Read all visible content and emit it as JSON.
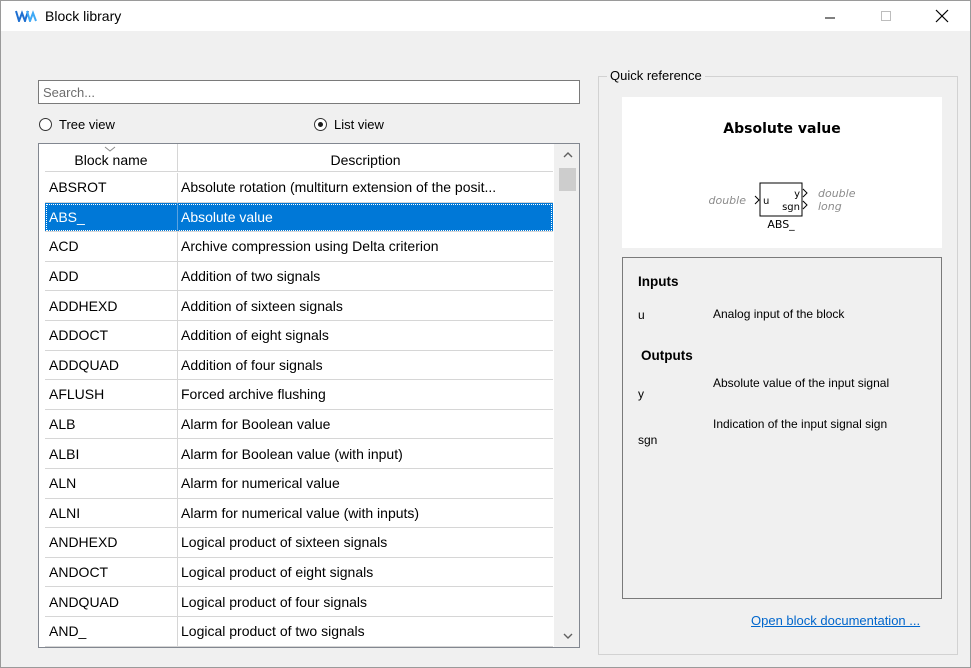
{
  "window": {
    "title": "Block library"
  },
  "search": {
    "placeholder": "Search..."
  },
  "view_mode": {
    "tree_label": "Tree view",
    "list_label": "List view",
    "selected": "list"
  },
  "table": {
    "columns": [
      "Block name",
      "Description"
    ],
    "selected_index": 1,
    "rows": [
      {
        "name": "ABSROT",
        "desc": "Absolute rotation (multiturn extension of the posit..."
      },
      {
        "name": "ABS_",
        "desc": "Absolute value"
      },
      {
        "name": "ACD",
        "desc": "Archive compression using Delta criterion"
      },
      {
        "name": "ADD",
        "desc": "Addition of two signals"
      },
      {
        "name": "ADDHEXD",
        "desc": "Addition of sixteen signals"
      },
      {
        "name": "ADDOCT",
        "desc": "Addition of eight signals"
      },
      {
        "name": "ADDQUAD",
        "desc": "Addition of four signals"
      },
      {
        "name": "AFLUSH",
        "desc": "Forced archive flushing"
      },
      {
        "name": "ALB",
        "desc": "Alarm for Boolean value"
      },
      {
        "name": "ALBI",
        "desc": "Alarm for Boolean value (with input)"
      },
      {
        "name": "ALN",
        "desc": "Alarm for numerical value"
      },
      {
        "name": "ALNI",
        "desc": "Alarm for numerical value (with inputs)"
      },
      {
        "name": "ANDHEXD",
        "desc": "Logical product of sixteen signals"
      },
      {
        "name": "ANDOCT",
        "desc": "Logical product of eight signals"
      },
      {
        "name": "ANDQUAD",
        "desc": "Logical product of four signals"
      },
      {
        "name": "AND_",
        "desc": "Logical product of two signals"
      }
    ]
  },
  "quick_reference": {
    "legend": "Quick reference",
    "block_title": "Absolute value",
    "block": {
      "name": "ABS_",
      "input_type": "double",
      "input_port": "u",
      "output_ports": [
        "y",
        "sgn"
      ],
      "output_types": [
        "double",
        "long"
      ]
    },
    "inputs_heading": "Inputs",
    "inputs": [
      {
        "name": "u",
        "desc": "Analog input of the block"
      }
    ],
    "outputs_heading": "Outputs",
    "outputs": [
      {
        "name": "y",
        "desc": "Absolute value of the input signal"
      },
      {
        "name": "sgn",
        "desc": "Indication of the input signal sign"
      }
    ],
    "doc_link": "Open block documentation ..."
  },
  "colors": {
    "selection": "#0078d7",
    "link": "#0066cc",
    "logo": "#1e6fd1"
  }
}
